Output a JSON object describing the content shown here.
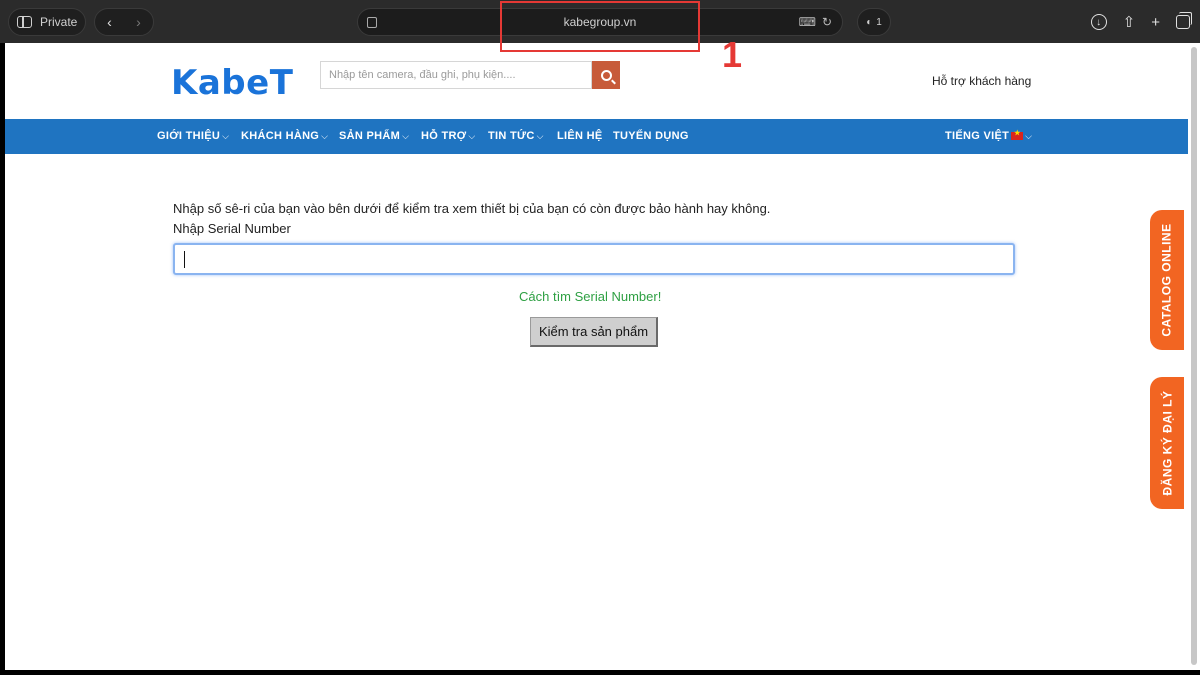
{
  "browser": {
    "private_label": "Private",
    "url": "kabegroup.vn",
    "tabs_count": "1",
    "back_glyph": "‹",
    "forward_glyph": "›"
  },
  "annotation": {
    "number": "1"
  },
  "header": {
    "logo_text": "KabeT",
    "search_placeholder": "Nhập tên camera, đầu ghi, phụ kiện....",
    "support_link": "Hỗ trợ khách hàng"
  },
  "nav": {
    "items": [
      {
        "label": "GIỚI THIỆU",
        "has_dropdown": true
      },
      {
        "label": "KHÁCH HÀNG",
        "has_dropdown": true
      },
      {
        "label": "SẢN PHẨM",
        "has_dropdown": true
      },
      {
        "label": "HỖ TRỢ",
        "has_dropdown": true
      },
      {
        "label": "TIN TỨC",
        "has_dropdown": true
      },
      {
        "label": "LIÊN HỆ",
        "has_dropdown": false
      },
      {
        "label": "TUYỂN DỤNG",
        "has_dropdown": false
      }
    ],
    "language": "TIẾNG VIỆT"
  },
  "warranty": {
    "instruction": "Nhập số sê-ri của bạn vào bên dưới để kiểm tra xem thiết bị của bạn có còn được bảo hành hay không.",
    "field_label": "Nhập Serial Number",
    "field_value": "",
    "howto_link": "Cách tìm Serial Number!",
    "submit_label": "Kiểm tra sản phẩm"
  },
  "side_tabs": {
    "catalog": "CATALOG ONLINE",
    "dealer": "ĐĂNG KÝ ĐẠI LÝ"
  },
  "colors": {
    "nav_bg": "#1f74c1",
    "logo": "#1a73d9",
    "search_button": "#c75b3a",
    "side_tab": "#f26522",
    "howto_link": "#2ea043",
    "annotation": "#e53935"
  }
}
